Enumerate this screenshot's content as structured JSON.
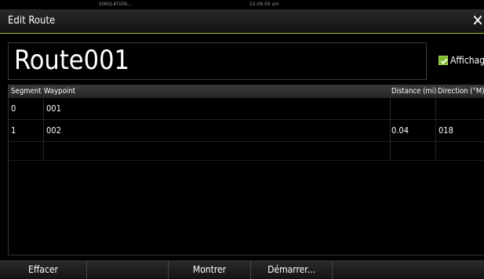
{
  "status_bar": {
    "mode": "SIMULATION...",
    "clock": "10:08:09 am"
  },
  "dialog": {
    "title": "Edit Route",
    "close_icon": "close-icon"
  },
  "route": {
    "name": "Route001"
  },
  "display_toggle": {
    "label": "Affichage",
    "checked": true,
    "color": "#7dbb2e"
  },
  "table": {
    "columns": [
      "Segment",
      "Waypoint",
      "Distance (mi)",
      "Direction (°M)"
    ],
    "rows": [
      {
        "segment": "0",
        "waypoint": "001",
        "distance": "",
        "direction": ""
      },
      {
        "segment": "1",
        "waypoint": "002",
        "distance": "0.04",
        "direction": "018"
      }
    ]
  },
  "buttons": {
    "delete": "Effacer",
    "show": "Montrer",
    "start": "Démarrer..."
  },
  "accent_color": "#aac43a"
}
